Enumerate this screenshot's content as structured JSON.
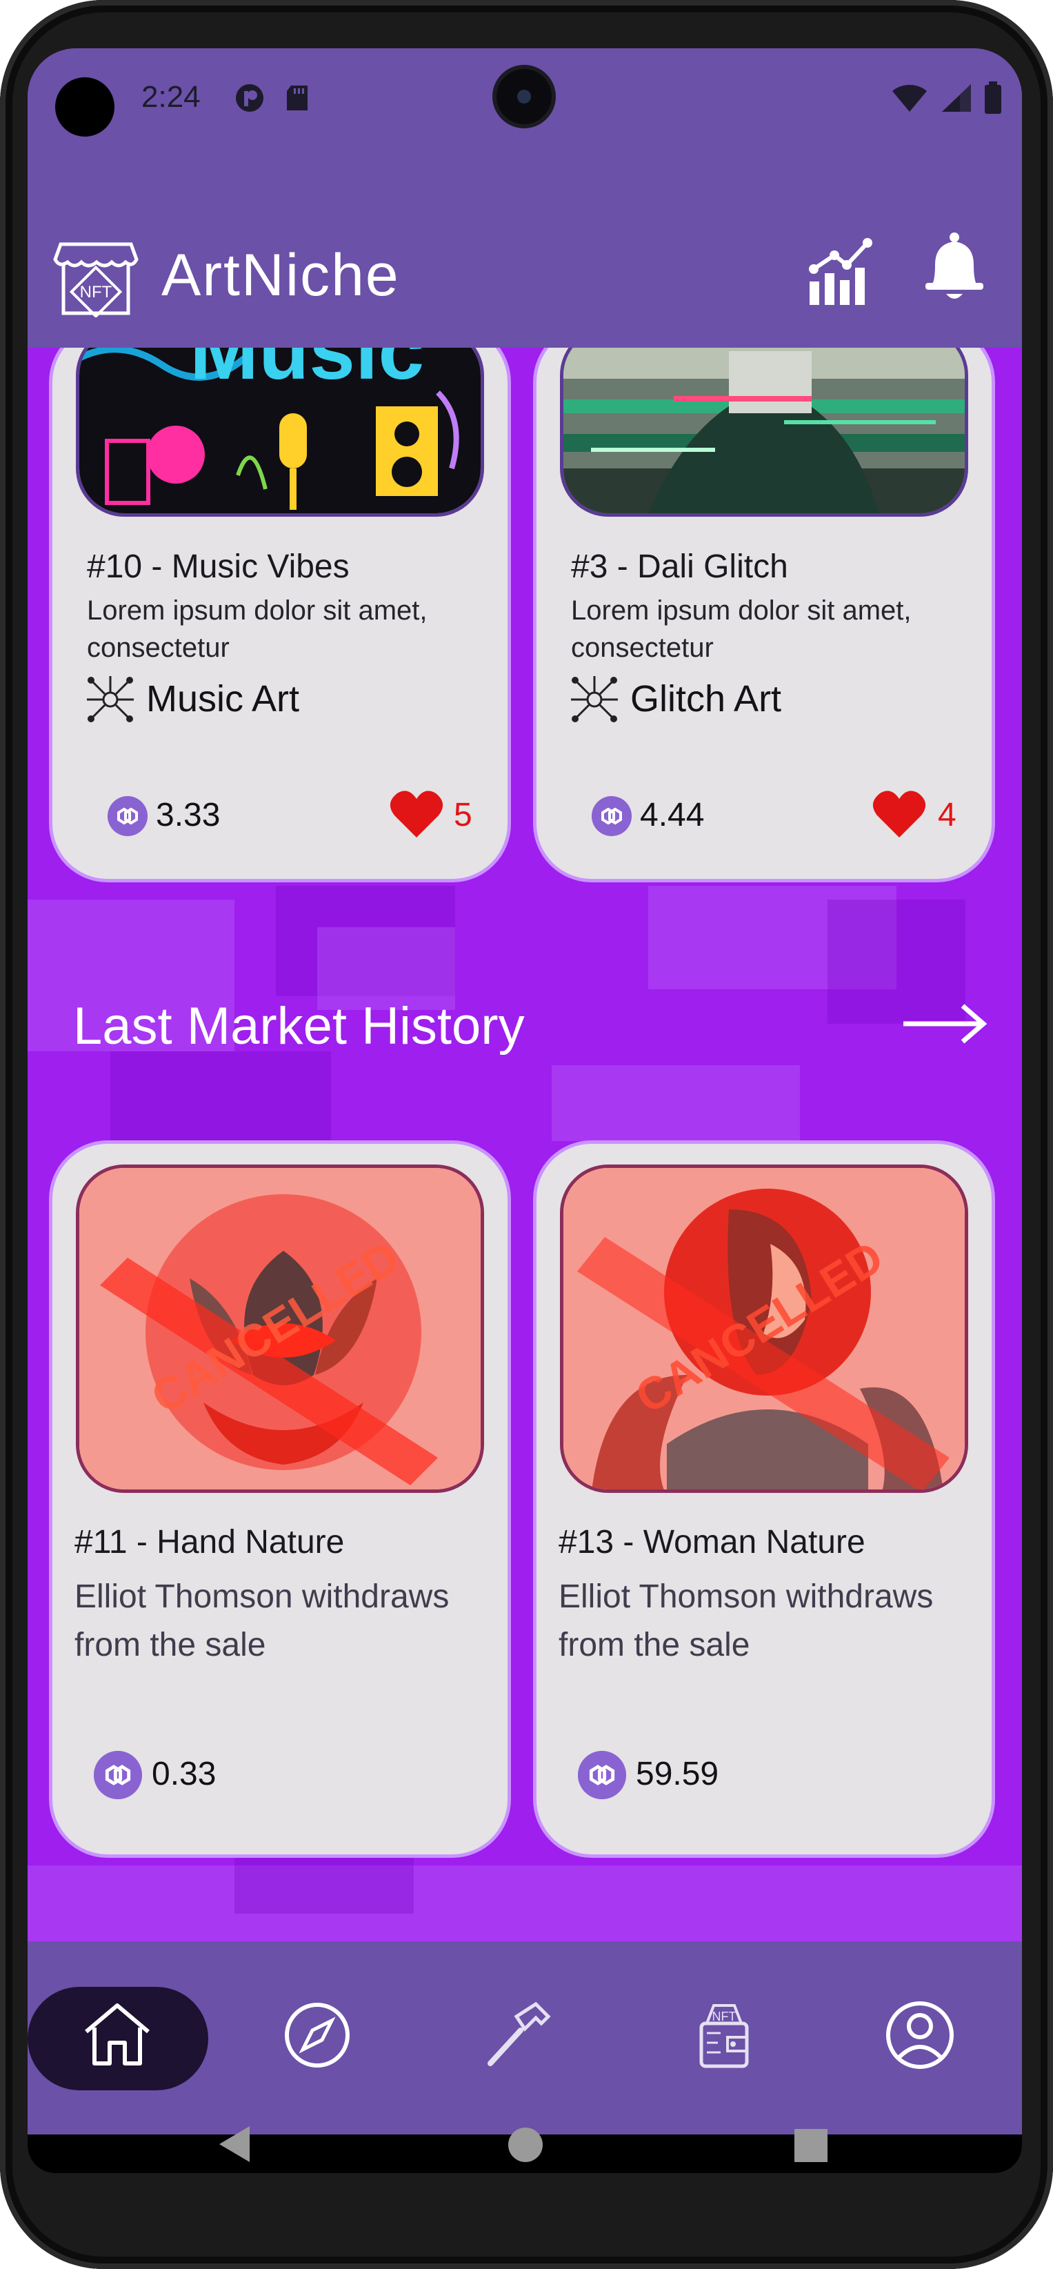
{
  "status_bar": {
    "time": "2:24"
  },
  "app": {
    "title": "ArtNiche",
    "logo_text": "NFT"
  },
  "cards_top": [
    {
      "title": "#10 - Music Vibes",
      "desc": "Lorem ipsum dolor sit amet, consectetur",
      "category": "Music Art",
      "price": "3.33",
      "likes": "5",
      "image_text": "Music"
    },
    {
      "title": "#3 - Dali Glitch",
      "desc": "Lorem ipsum dolor sit amet, consectetur",
      "category": "Glitch Art",
      "price": "4.44",
      "likes": "4"
    }
  ],
  "history": {
    "title": "Last Market History",
    "items": [
      {
        "title": "#11 - Hand Nature",
        "desc": "Elliot Thomson withdraws from the sale",
        "price": "0.33",
        "stamp": "CANCELLED"
      },
      {
        "title": "#13 - Woman Nature",
        "desc": "Elliot Thomson withdraws from the sale",
        "price": "59.59",
        "stamp": "CANCELLED"
      }
    ]
  },
  "colors": {
    "header": "#6b51a8",
    "background": "#9e1fee",
    "card": "#e5e3e5",
    "like": "#e11515",
    "accent": "#8a63d2"
  },
  "nav": [
    "home-icon",
    "compass-icon",
    "hammer-icon",
    "nft-wallet-icon",
    "profile-icon"
  ]
}
